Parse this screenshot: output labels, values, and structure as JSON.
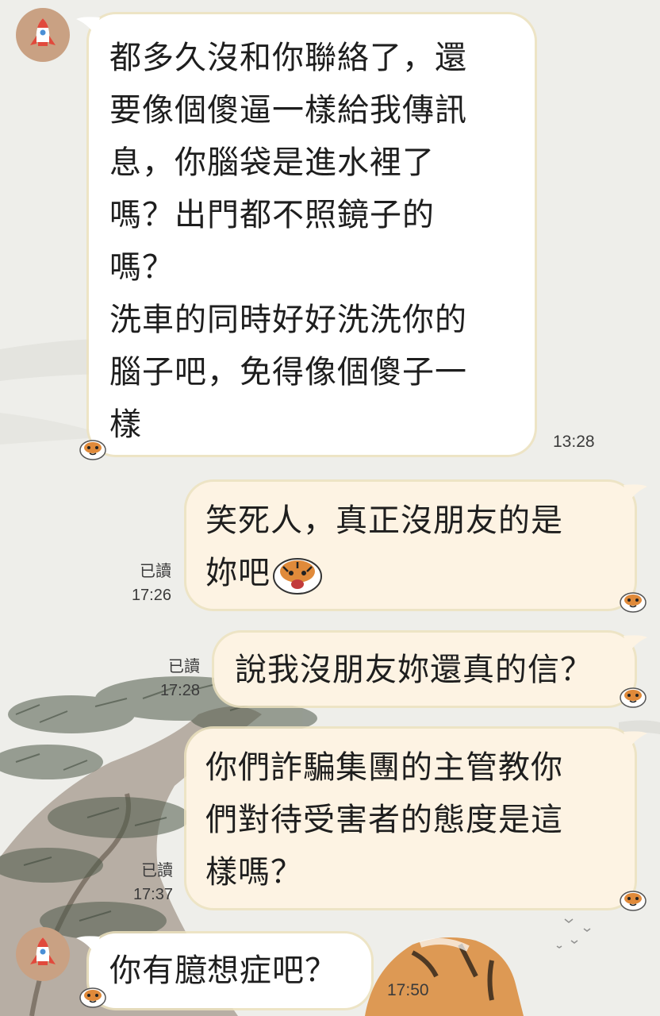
{
  "messages": [
    {
      "direction": "incoming",
      "text": "都多久沒和你聯絡了，還\n要像個傻逼一樣給我傳訊\n息，你腦袋是進水裡了\n嗎？出門都不照鏡子的\n嗎？\n洗車的同時好好洗洗你的\n腦子吧，免得像個傻子一\n樣",
      "time": "13:28"
    },
    {
      "direction": "outgoing",
      "text": "笑死人，真正沒朋友的是\n妳吧",
      "read": "已讀",
      "time": "17:26"
    },
    {
      "direction": "outgoing",
      "text": "說我沒朋友妳還真的信？",
      "read": "已讀",
      "time": "17:28"
    },
    {
      "direction": "outgoing",
      "text": "你們詐騙集團的主管教你\n們對待受害者的態度是這\n樣嗎？",
      "read": "已讀",
      "time": "17:37"
    },
    {
      "direction": "incoming",
      "text": "你有臆想症吧？",
      "time": "17:50"
    }
  ],
  "icons": {
    "avatar": "rocket-avatar-icon",
    "sticker": "tiger-face-icon"
  },
  "colors": {
    "background": "#eeeeea",
    "incoming_bubble": "#ffffff",
    "outgoing_bubble": "#fdf3e3",
    "bubble_border": "#ece2be"
  }
}
